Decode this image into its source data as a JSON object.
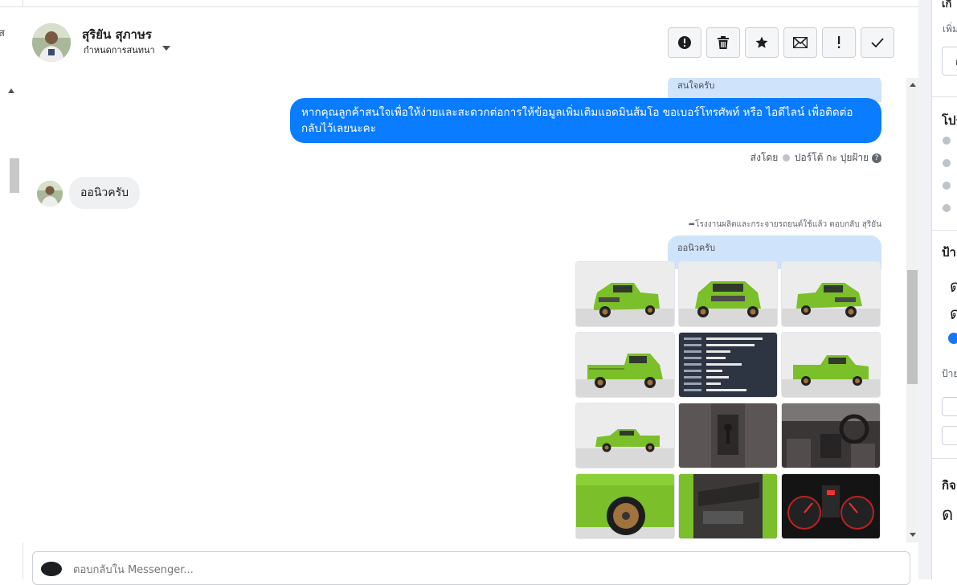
{
  "left_col": {
    "glyph": "ส"
  },
  "header": {
    "contact_name": "สุริยัน สุภาษร",
    "assign_label": "กำหนดการสนทนา",
    "actions": [
      {
        "name": "spam-button",
        "icon": "alert-circle-icon"
      },
      {
        "name": "delete-button",
        "icon": "trash-icon"
      },
      {
        "name": "star-button",
        "icon": "star-icon"
      },
      {
        "name": "mark-unread-button",
        "icon": "envelope-icon"
      },
      {
        "name": "follow-up-button",
        "icon": "exclamation-icon"
      },
      {
        "name": "done-button",
        "icon": "check-icon"
      }
    ]
  },
  "chat": {
    "msg1_reply_preview": "สนใจครับ",
    "msg1_text": "หากคุณลูกค้าสนใจเพื่อให้ง่ายและสะดวกต่อการให้ข้อมูลเพิ่มเติมแอดมินส้มโอ ขอเบอร์โทรศัพท์ หรือ ไอดีไลน์ เพื่อติดต่อกลับไว้เลยนะคะ",
    "sent_by_prefix": "ส่งโดย",
    "sent_by_name": "ปอร์โต้ กะ ปุยฝ้าย",
    "incoming_text": "ออนิวครับ",
    "reply_info": "โรงงานผลิตและกระจายรถยนต์ใช้แล้ว ตอบกลับ สุริยัน",
    "msg2_reply_preview": "ออนิวครับ",
    "photos": [
      {
        "kind": "truck-front-left"
      },
      {
        "kind": "truck-front"
      },
      {
        "kind": "truck-front-right"
      },
      {
        "kind": "truck-rear"
      },
      {
        "kind": "spec-sheet"
      },
      {
        "kind": "truck-side-right"
      },
      {
        "kind": "truck-side-left"
      },
      {
        "kind": "interior-gear"
      },
      {
        "kind": "interior-dashboard"
      },
      {
        "kind": "wheel-closeup"
      },
      {
        "kind": "door-panel"
      },
      {
        "kind": "gauge-cluster"
      }
    ]
  },
  "composer": {
    "placeholder": "ตอบกลับใน Messenger..."
  },
  "right_panel": {
    "heading1": "เกี่",
    "sub1": "เพิ่ม",
    "box1": "เ",
    "heading2": "โปร",
    "heading3": "ป้าย",
    "tag1": "ด",
    "tag2": "ด",
    "sub3": "ป้าย",
    "heading4": "กิจ",
    "val4": "ด"
  },
  "colors": {
    "messenger_blue": "#0a7cff",
    "reply_preview": "#cfe4fb",
    "incoming_bubble": "#eff0f2",
    "truck_green": "#7bbf2a"
  }
}
